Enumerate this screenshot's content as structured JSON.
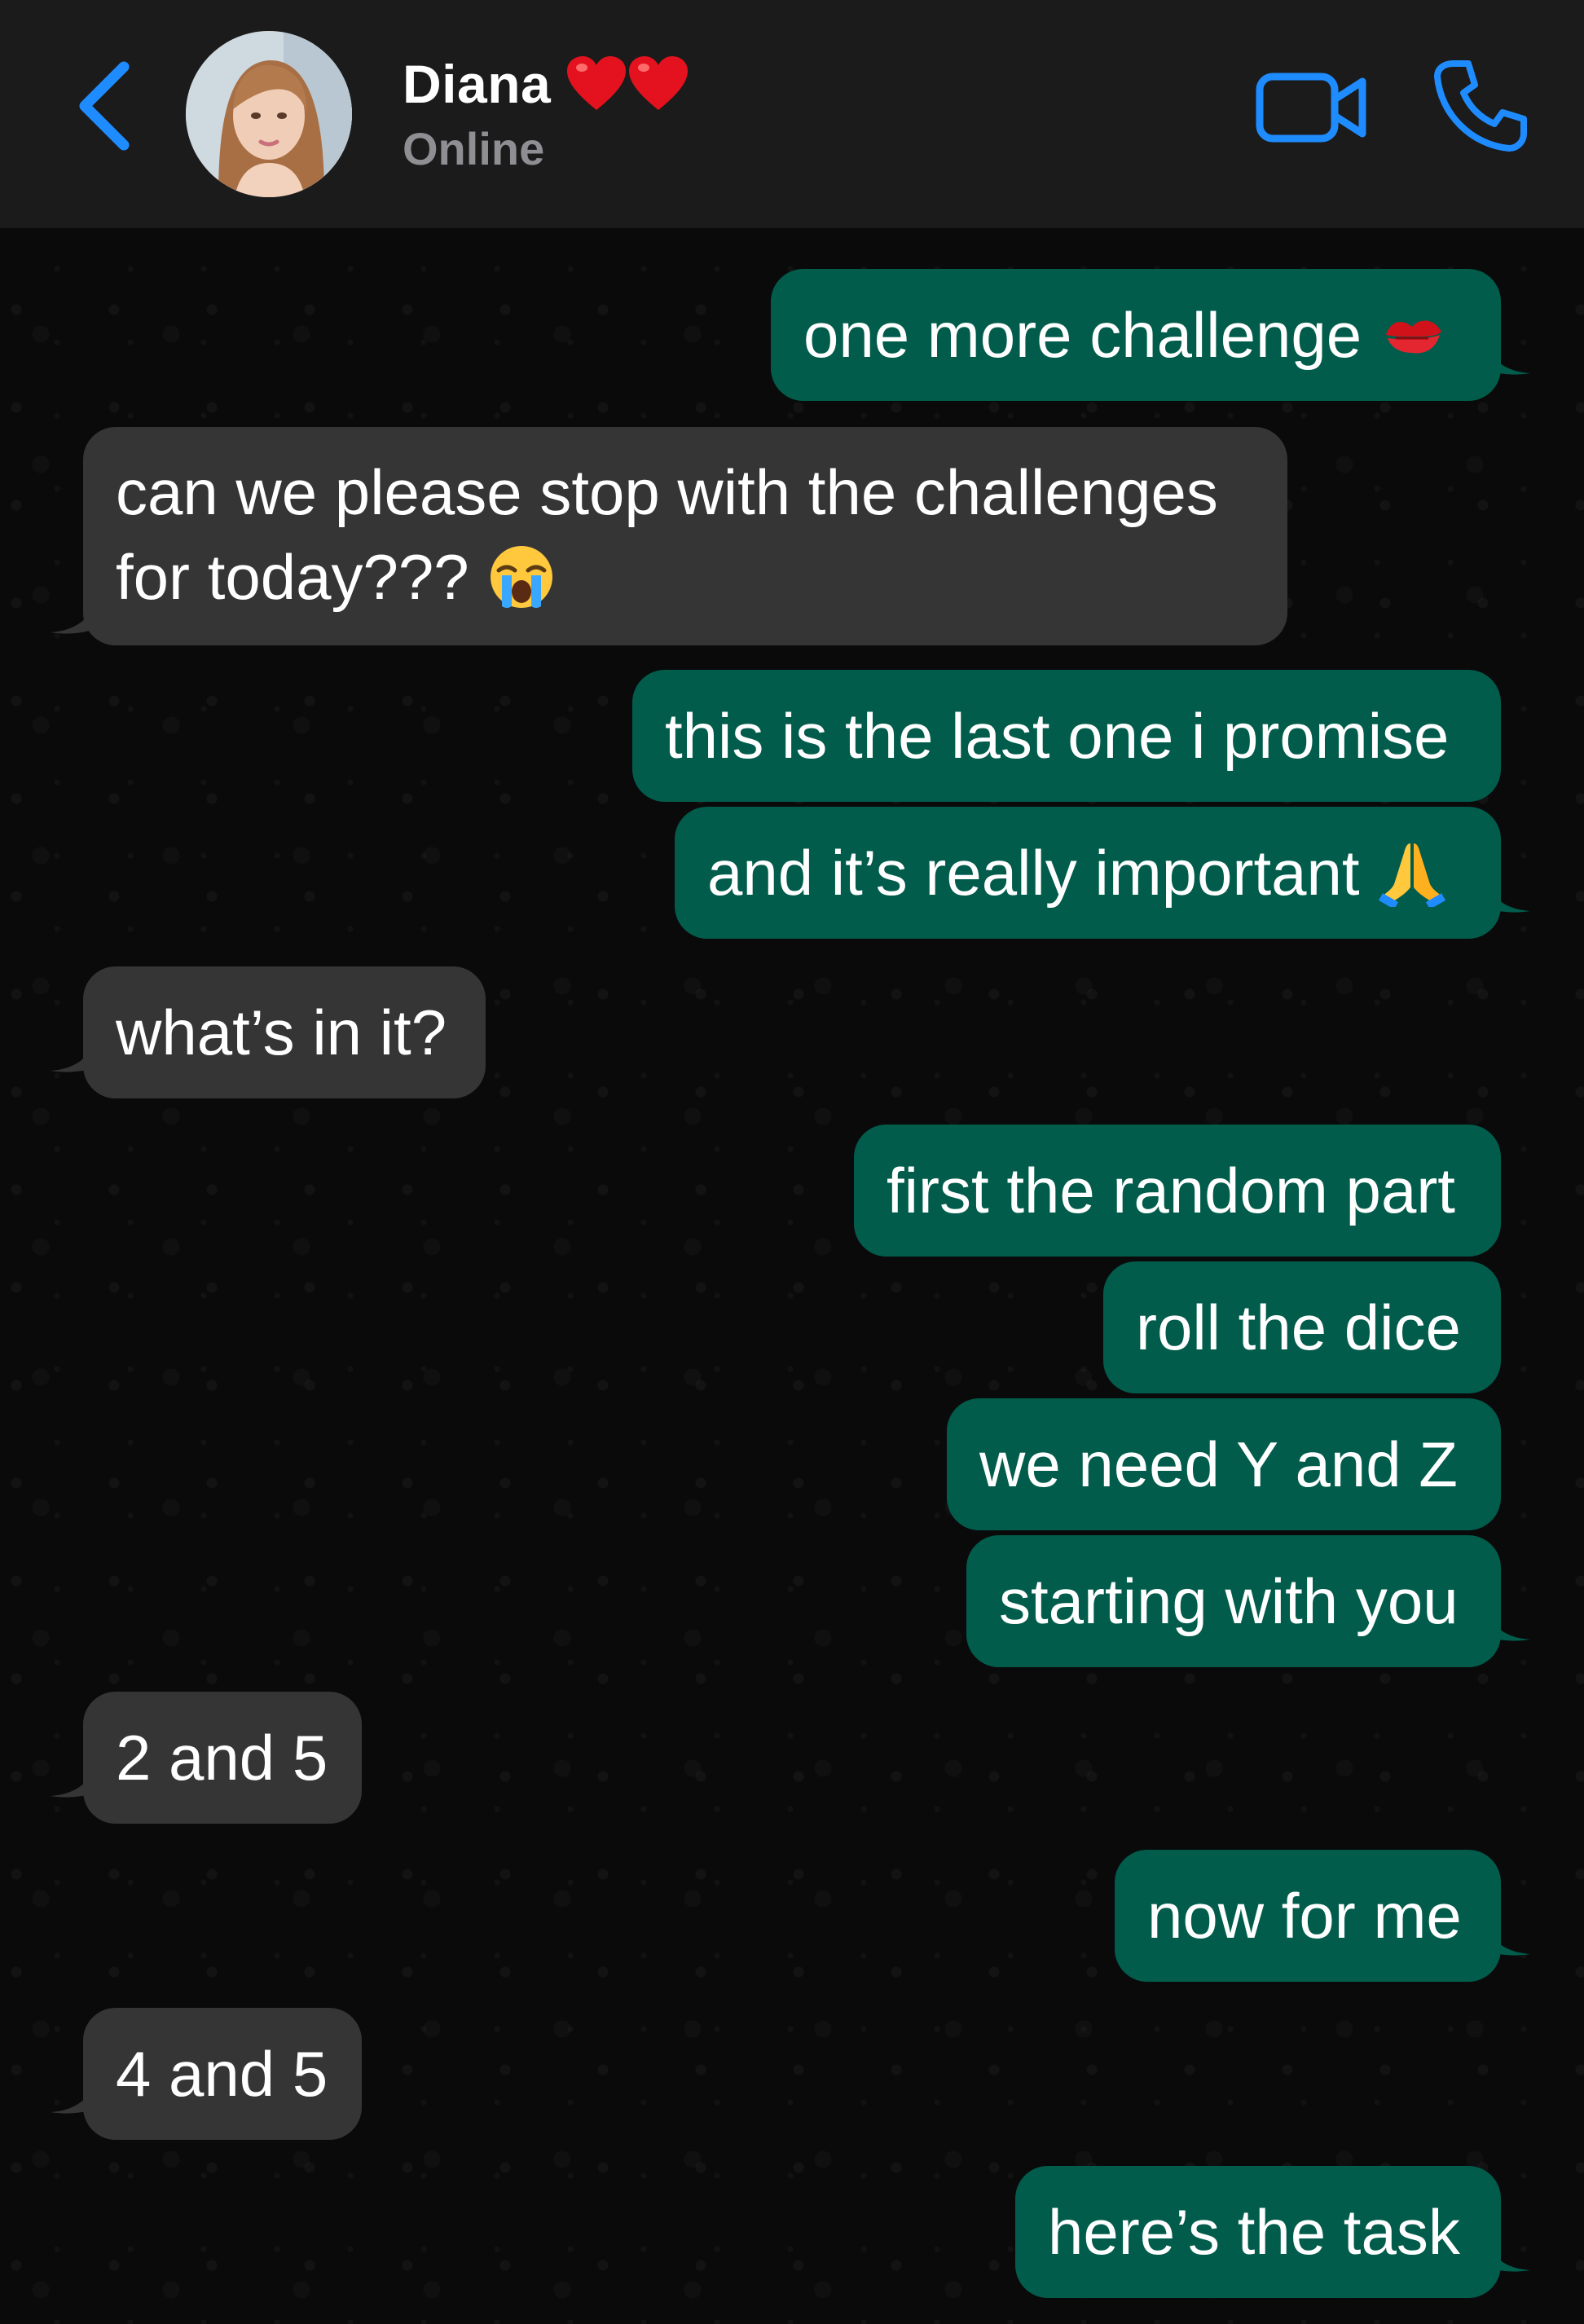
{
  "header": {
    "contact_name": "Diana",
    "status": "Online",
    "icons": [
      "chevron-left-icon",
      "avatar",
      "red-heart-emoji",
      "video-camera-icon",
      "phone-icon"
    ],
    "accent_color": "#1e8cff"
  },
  "messages": [
    {
      "direction": "out",
      "text": "one more challenge",
      "emoji": "kiss-mark-emoji"
    },
    {
      "direction": "in",
      "line1": "can we please stop with the challenges",
      "line2": "for today???",
      "emoji": "loudly-crying-face-emoji"
    },
    {
      "direction": "out",
      "text": "this is the last one i promise"
    },
    {
      "direction": "out",
      "text": "and it’s really important",
      "emoji": "folded-hands-emoji"
    },
    {
      "direction": "in",
      "text": "what’s in it?"
    },
    {
      "direction": "out",
      "text": "first the random part"
    },
    {
      "direction": "out",
      "text": "roll the dice"
    },
    {
      "direction": "out",
      "text": "we need Y and Z"
    },
    {
      "direction": "out",
      "text": "starting with you"
    },
    {
      "direction": "in",
      "text": "2 and 5"
    },
    {
      "direction": "out",
      "text": "now for me"
    },
    {
      "direction": "in",
      "text": "4 and 5"
    },
    {
      "direction": "out",
      "text": "here’s the task"
    }
  ],
  "colors": {
    "outgoing_bubble": "#015c4b",
    "incoming_bubble": "#353535",
    "header_bg": "#1b1b1b",
    "chat_bg": "#0a0a0a"
  }
}
